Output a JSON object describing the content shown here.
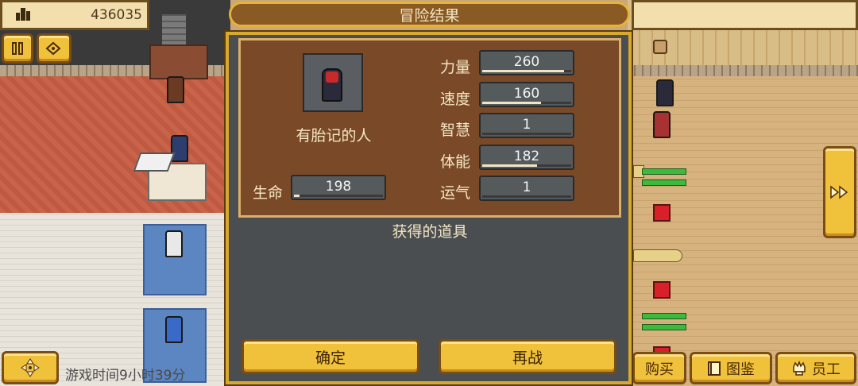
{
  "hud": {
    "money": "436035",
    "money_icon": "building-icon",
    "pause_icon": "pause-icon",
    "speed_icon": "speed-icon",
    "move_icon": "move-arrows-icon",
    "forward_icon": "fast-forward-icon",
    "game_time": "游戏时间9小时39分"
  },
  "dialog": {
    "title": "冒险结果",
    "character_name": "有胎记的人",
    "hp": {
      "label": "生命",
      "value": "198",
      "fill": 0.06
    },
    "stats": [
      {
        "label": "力量",
        "value": "260",
        "fill": 0.92
      },
      {
        "label": "速度",
        "value": "160",
        "fill": 0.66
      },
      {
        "label": "智慧",
        "value": "1",
        "fill": 0.0
      },
      {
        "label": "体能",
        "value": "182",
        "fill": 0.62
      },
      {
        "label": "运气",
        "value": "1",
        "fill": 0.0
      }
    ],
    "items_title": "获得的道具",
    "confirm_label": "确定",
    "retry_label": "再战"
  },
  "bottom_bar": {
    "buy_label": "购买",
    "catalog_label": "图鉴",
    "staff_label": "员工"
  },
  "colors": {
    "gold": "#f0c23c",
    "panel_brown": "#7a4a28",
    "dialog_bg": "#4a4e50"
  }
}
